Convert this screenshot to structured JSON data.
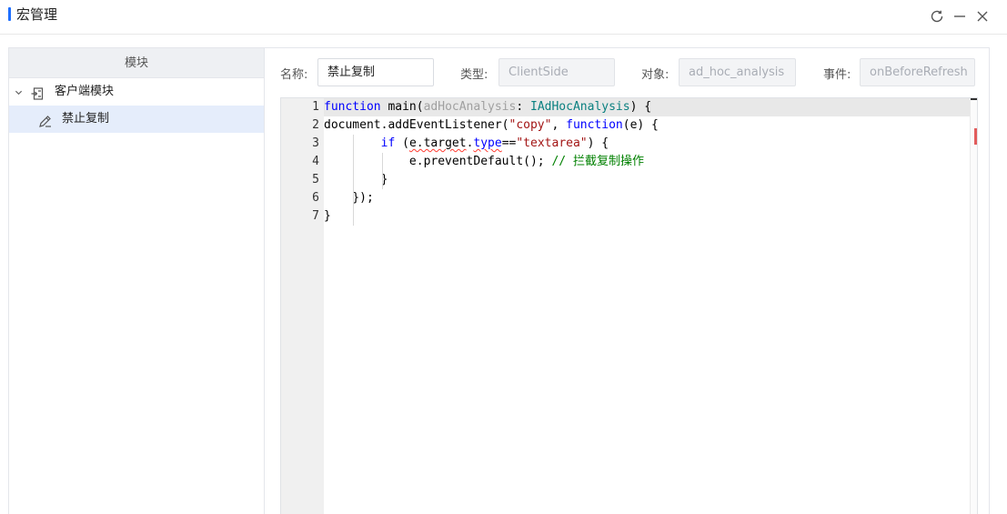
{
  "window": {
    "title": "宏管理"
  },
  "left": {
    "header": "模块",
    "tree": {
      "root_label": "客户端模块",
      "child_label": "禁止复制"
    }
  },
  "form": {
    "name_label": "名称:",
    "name_value": "禁止复制",
    "type_label": "类型:",
    "type_value": "ClientSide",
    "object_label": "对象:",
    "object_value": "ad_hoc_analysis",
    "event_label": "事件:",
    "event_value": "onBeforeRefresh"
  },
  "editor": {
    "line_numbers": [
      "1",
      "2",
      "3",
      "4",
      "5",
      "6",
      "7"
    ],
    "lines": {
      "l1": {
        "kw1": "function",
        "t1": " main(",
        "param": "adHocAnalysis",
        "t2": ": ",
        "type": "IAdHocAnalysis",
        "t3": ") {"
      },
      "l2": {
        "t1": "document.addEventListener(",
        "str": "\"copy\"",
        "t2": ", ",
        "kw": "function",
        "t3": "(e) {"
      },
      "l3": {
        "indent": "        ",
        "kw": "if",
        "t1": " (",
        "sq1": "e.target",
        "t2": ".",
        "sq2": "type",
        "t3": "==",
        "str": "\"textarea\"",
        "t4": ") {"
      },
      "l4": {
        "indent": "            ",
        "t1": "e.preventDefault(); ",
        "cmt": "// 拦截复制操作"
      },
      "l5": {
        "text": "        }"
      },
      "l6": {
        "text": "    });"
      },
      "l7": {
        "text": "}"
      }
    }
  },
  "icons": {
    "refresh": "refresh-icon",
    "minimize": "minimize-icon",
    "close": "close-icon",
    "expand": "chevron-down-icon",
    "module": "module-icon",
    "script": "script-edit-icon"
  },
  "colors": {
    "accent": "#1e6fff",
    "selected_row": "#e5edfb",
    "keyword": "#0000ff",
    "string": "#a31515",
    "comment": "#008000",
    "type": "#0b8080"
  }
}
